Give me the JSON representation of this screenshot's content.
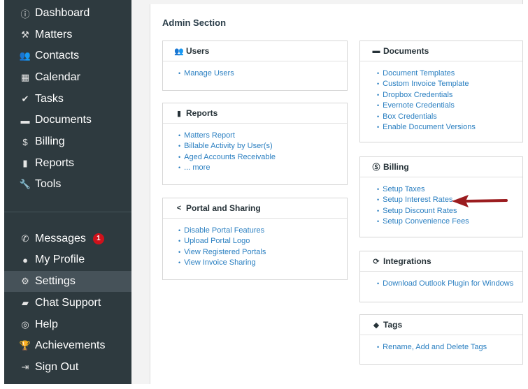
{
  "sidebar": {
    "top_items": [
      {
        "label": "Dashboard",
        "icon": "info-circle-icon",
        "glyph": "ⓘ"
      },
      {
        "label": "Matters",
        "icon": "gavel-icon",
        "glyph": "⚒"
      },
      {
        "label": "Contacts",
        "icon": "contacts-icon",
        "glyph": "👥"
      },
      {
        "label": "Calendar",
        "icon": "calendar-icon",
        "glyph": "▦"
      },
      {
        "label": "Tasks",
        "icon": "check-icon",
        "glyph": "✔"
      },
      {
        "label": "Documents",
        "icon": "folder-icon",
        "glyph": "▬"
      },
      {
        "label": "Billing",
        "icon": "dollar-circle-icon",
        "glyph": "$"
      },
      {
        "label": "Reports",
        "icon": "bar-chart-icon",
        "glyph": "▮"
      },
      {
        "label": "Tools",
        "icon": "wrench-icon",
        "glyph": "🔧"
      }
    ],
    "bottom_items": [
      {
        "label": "Messages",
        "icon": "phone-icon",
        "glyph": "✆",
        "badge": "1"
      },
      {
        "label": "My Profile",
        "icon": "user-icon",
        "glyph": "●"
      },
      {
        "label": "Settings",
        "icon": "gear-icon",
        "glyph": "⚙",
        "active": true
      },
      {
        "label": "Chat Support",
        "icon": "chat-icon",
        "glyph": "▰"
      },
      {
        "label": "Help",
        "icon": "lifebuoy-icon",
        "glyph": "◎"
      },
      {
        "label": "Achievements",
        "icon": "trophy-icon",
        "glyph": "🏆"
      },
      {
        "label": "Sign Out",
        "icon": "sign-out-icon",
        "glyph": "⇥"
      }
    ]
  },
  "main": {
    "title": "Admin Section",
    "panels": {
      "users": {
        "title": "Users",
        "icon": "users-icon",
        "links": [
          "Manage Users"
        ]
      },
      "reports": {
        "title": "Reports",
        "icon": "bar-chart-icon",
        "links": [
          "Matters Report",
          "Billable Activity by User(s)",
          "Aged Accounts Receivable",
          "... more"
        ]
      },
      "portal": {
        "title": "Portal and Sharing",
        "icon": "share-icon",
        "links": [
          "Disable Portal Features",
          "Upload Portal Logo",
          "View Registered Portals",
          "View Invoice Sharing"
        ]
      },
      "documents": {
        "title": "Documents",
        "icon": "folder-icon",
        "links": [
          "Document Templates",
          "Custom Invoice Template",
          "Dropbox Credentials",
          "Evernote Credentials",
          "Box Credentials",
          "Enable Document Versions"
        ]
      },
      "billing": {
        "title": "Billing",
        "icon": "dollar-circle-icon",
        "links": [
          "Setup Taxes",
          "Setup Interest Rates",
          "Setup Discount Rates",
          "Setup Convenience Fees"
        ]
      },
      "integrations": {
        "title": "Integrations",
        "icon": "sync-icon",
        "links": [
          "Download Outlook Plugin for Windows"
        ]
      },
      "tags": {
        "title": "Tags",
        "icon": "tag-icon",
        "links": [
          "Rename, Add and Delete Tags"
        ]
      }
    }
  },
  "colors": {
    "sidebar_bg": "#2e3a3f",
    "active_bg": "#465259",
    "link": "#2a7fc1",
    "badge": "#d0111b",
    "arrow": "#9b1c1f"
  }
}
